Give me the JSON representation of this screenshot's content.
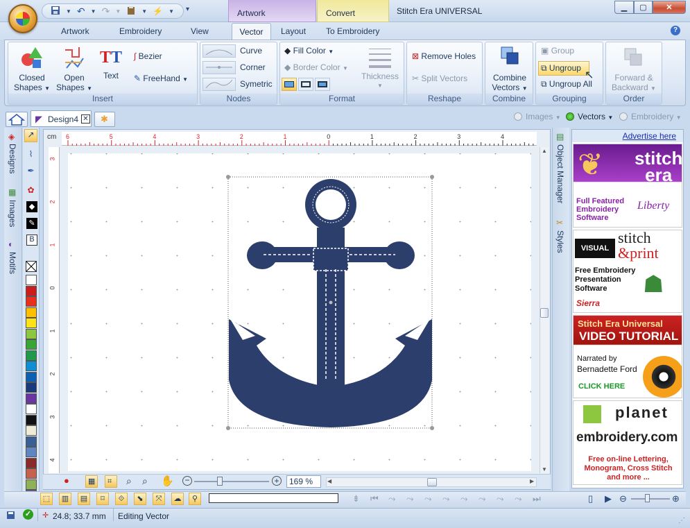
{
  "app": {
    "title": "Stitch Era UNIVERSAL",
    "context_tabs": [
      "Artwork",
      "Convert"
    ]
  },
  "tabs": [
    "Artwork",
    "Embroidery",
    "View",
    "Vector",
    "Layout",
    "To Embroidery"
  ],
  "active_tab": "Vector",
  "ribbon": {
    "insert": {
      "label": "Insert",
      "closed_shapes": [
        "Closed",
        "Shapes"
      ],
      "open_shapes": [
        "Open",
        "Shapes"
      ],
      "text": "Text",
      "bezier": "Bezier",
      "freehand": "FreeHand"
    },
    "nodes": {
      "label": "Nodes",
      "curve": "Curve",
      "corner": "Corner",
      "symetric": "Symetric"
    },
    "format": {
      "label": "Format",
      "fill_color": "Fill Color",
      "border_color": "Border Color",
      "thickness": "Thickness"
    },
    "reshape": {
      "label": "Reshape",
      "remove_holes": "Remove Holes",
      "split_vectors": "Split Vectors"
    },
    "combine": {
      "label": "Combine",
      "combine_vectors": [
        "Combine",
        "Vectors"
      ]
    },
    "grouping": {
      "label": "Grouping",
      "group": "Group",
      "ungroup": "Ungroup",
      "ungroup_all": "Ungroup All"
    },
    "order": {
      "label": "Order",
      "forward_backward": [
        "Forward &",
        "Backward"
      ]
    }
  },
  "doc_tabs": {
    "design": "Design4"
  },
  "view_modes": {
    "images": "Images",
    "vectors": "Vectors",
    "embroidery": "Embroidery",
    "selected": "Vectors"
  },
  "left_panels": [
    "Designs",
    "Images",
    "Motifs"
  ],
  "right_panels": [
    "Object Manager",
    "Styles"
  ],
  "ruler": {
    "unit": "cm",
    "h_ticks": [
      "6",
      "5",
      "4",
      "3",
      "2",
      "1",
      "0",
      "1",
      "2",
      "3",
      "4"
    ],
    "v_ticks": [
      "3",
      "2",
      "1",
      "0",
      "1",
      "2",
      "3",
      "4"
    ]
  },
  "zoom": "169 %",
  "palette": [
    "#ffffff",
    "#cc1d1d",
    "#e8301d",
    "#ffc000",
    "#ffe31a",
    "#8dc63f",
    "#3aa535",
    "#1f9a4a",
    "#0e8fd4",
    "#0c5fb3",
    "#1a3a7a",
    "#6a37a0",
    "#ffffff",
    "#111111",
    "#f0ead8",
    "#3a5f95",
    "#5f86c2",
    "#8a2a2a",
    "#c86050",
    "#8fb15a",
    "#7b5fb3"
  ],
  "ads": {
    "header": "Advertise here",
    "ad1": {
      "brand": [
        "stitch",
        "era"
      ],
      "lines": [
        "Full Featured",
        "Embroidery",
        "Software"
      ],
      "script": "Liberty"
    },
    "ad2": {
      "visual": "VISUAL",
      "brand": [
        "stitch",
        "&print"
      ],
      "lines": [
        "Free Embroidery",
        "Presentation",
        "Software"
      ],
      "sierra": "Sierra"
    },
    "ad3": {
      "title": "Stitch Era Universal",
      "subtitle": "VIDEO TUTORIAL",
      "narrated": "Narrated by",
      "narrator": "Bernadette Ford",
      "cta": "CLICK HERE"
    },
    "ad4": {
      "brand": [
        "planet",
        "embroidery.com"
      ],
      "lines": [
        "Free on-line Lettering,",
        "Monogram, Cross Stitch",
        "and more ..."
      ]
    }
  },
  "status": {
    "coords": "24.8; 33.7 mm",
    "message": "Editing Vector"
  },
  "colors": {
    "anchor": "#2c3e6b",
    "accent": "#f6c75a"
  }
}
